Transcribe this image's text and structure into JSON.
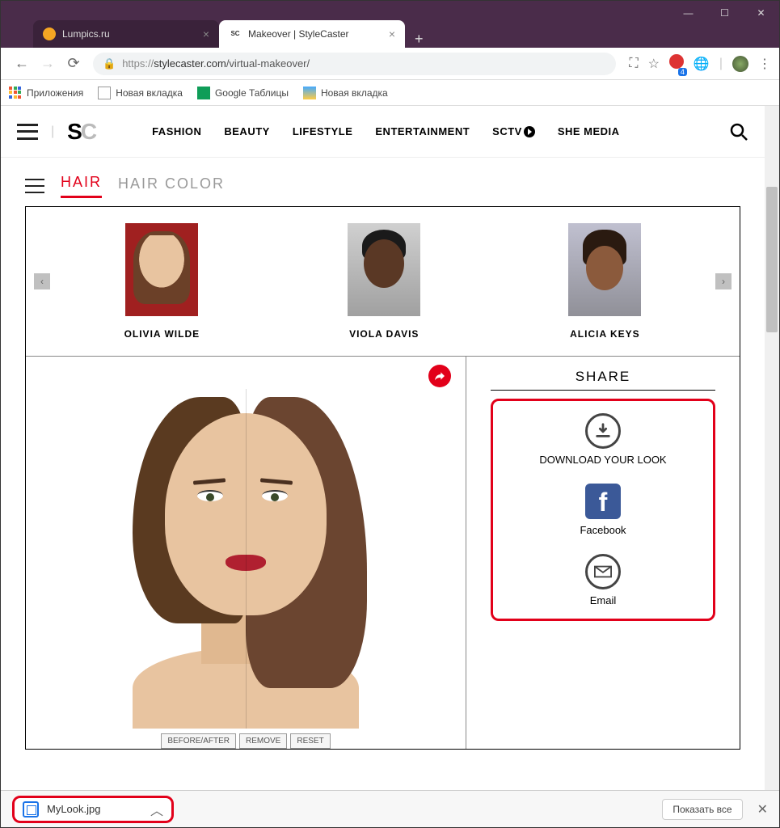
{
  "window": {
    "tabs": [
      {
        "title": "Lumpics.ru",
        "active": false,
        "favicon_color": "#f5a623"
      },
      {
        "title": "Makeover | StyleCaster",
        "active": true,
        "favicon_text": "SC"
      }
    ],
    "controls": {
      "min": "—",
      "max": "☐",
      "close": "✕"
    }
  },
  "addressbar": {
    "url_prefix": "https://",
    "url_host": "stylecaster.com",
    "url_path": "/virtual-makeover/",
    "badge_count": "4"
  },
  "bookmarks": {
    "apps": "Приложения",
    "items": [
      "Новая вкладка",
      "Google Таблицы",
      "Новая вкладка"
    ]
  },
  "site_nav": [
    "FASHION",
    "BEAUTY",
    "LIFESTYLE",
    "ENTERTAINMENT",
    "SCTV",
    "SHE MEDIA"
  ],
  "sub_tabs": {
    "active": "HAIR",
    "inactive": "HAIR COLOR"
  },
  "celebs": [
    {
      "name": "OLIVIA WILDE"
    },
    {
      "name": "VIOLA DAVIS"
    },
    {
      "name": "ALICIA KEYS"
    }
  ],
  "controls_row": [
    "BEFORE/AFTER",
    "REMOVE",
    "RESET"
  ],
  "share": {
    "title": "SHARE",
    "download": "DOWNLOAD YOUR LOOK",
    "facebook": "Facebook",
    "email": "Email"
  },
  "download_bar": {
    "filename": "MyLook.jpg",
    "show_all": "Показать все"
  }
}
